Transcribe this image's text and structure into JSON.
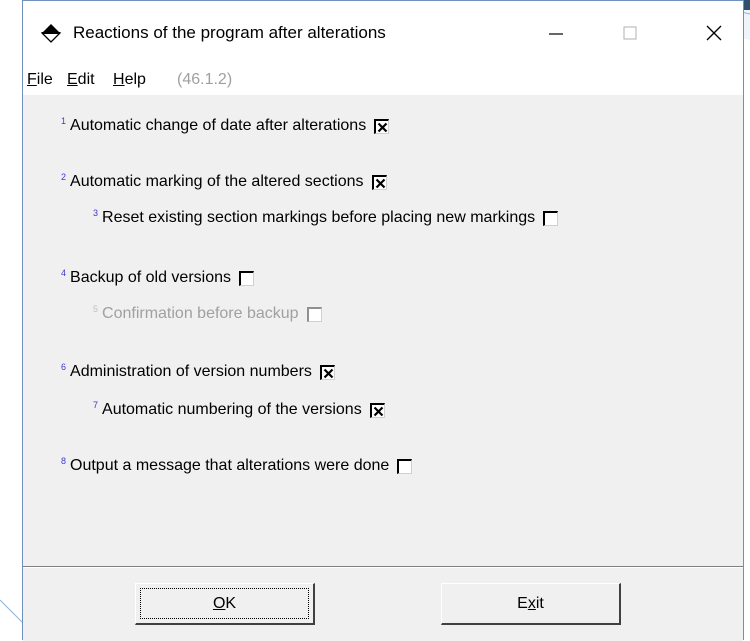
{
  "window": {
    "title": "Reactions of the program after alterations",
    "icons": {
      "app": "app-diamond-icon",
      "minimize": "minimize-icon",
      "maximize": "maximize-icon",
      "close": "close-icon"
    }
  },
  "menu": {
    "file": {
      "mnemonic": "F",
      "rest": "ile"
    },
    "edit": {
      "mnemonic": "E",
      "rest": "dit"
    },
    "help": {
      "mnemonic": "H",
      "rest": "elp"
    },
    "version": "(46.1.2)"
  },
  "options": [
    {
      "num": "1",
      "label": "Automatic change of date after alterations",
      "checked": true,
      "enabled": true
    },
    {
      "num": "2",
      "label": "Automatic marking of the altered sections",
      "checked": true,
      "enabled": true
    },
    {
      "num": "3",
      "label": "Reset existing section markings before placing new markings",
      "checked": false,
      "enabled": true
    },
    {
      "num": "4",
      "label": "Backup of old versions",
      "checked": false,
      "enabled": true
    },
    {
      "num": "5",
      "label": "Confirmation before backup",
      "checked": false,
      "enabled": false
    },
    {
      "num": "6",
      "label": "Administration of version numbers",
      "checked": true,
      "enabled": true
    },
    {
      "num": "7",
      "label": "Automatic numbering of the versions",
      "checked": true,
      "enabled": true
    },
    {
      "num": "8",
      "label": "Output a message that alterations were done",
      "checked": false,
      "enabled": true
    }
  ],
  "buttons": {
    "ok": {
      "mnemonic": "O",
      "rest": "K"
    },
    "exit": {
      "pre": "E",
      "mnemonic": "x",
      "rest": "it"
    }
  }
}
